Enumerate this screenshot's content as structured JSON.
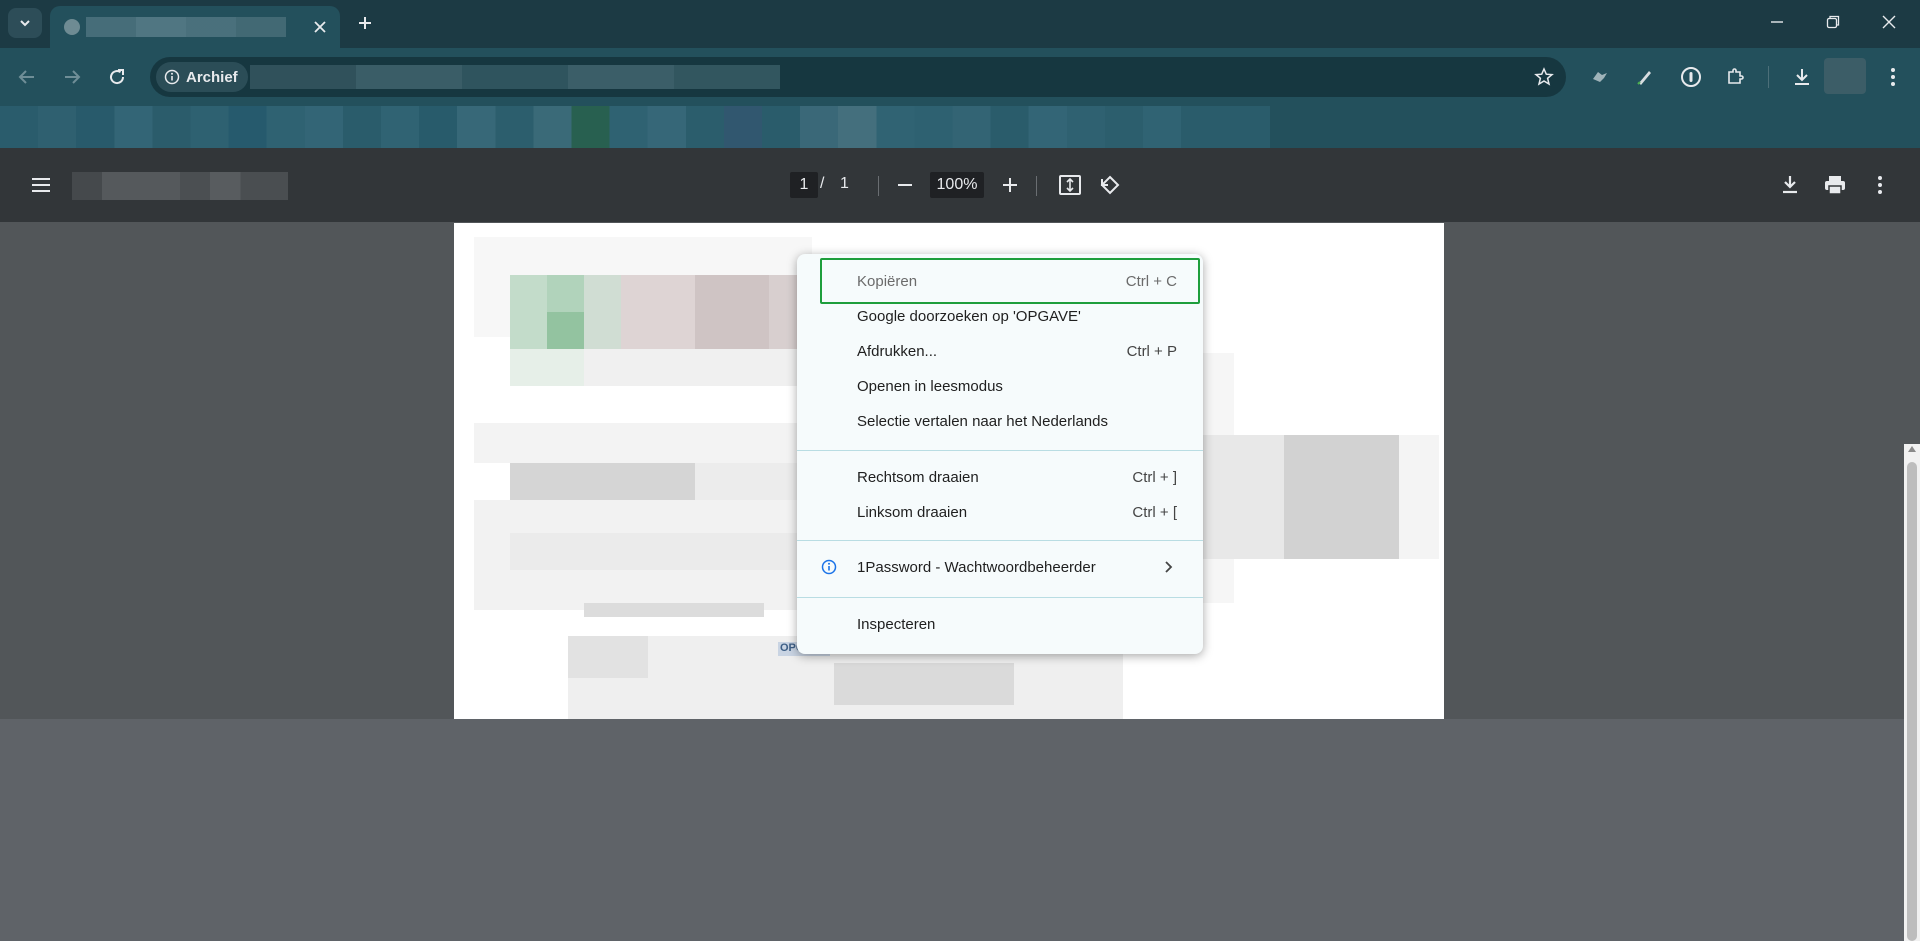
{
  "browser": {
    "site_chip_label": "Archief",
    "icons": {
      "tab_search": "chevron-down-icon",
      "tab_close": "close-icon",
      "new_tab": "plus-icon",
      "minimize": "minimize-icon",
      "restore": "restore-icon",
      "close_window": "close-icon",
      "back": "back-arrow-icon",
      "forward": "forward-arrow-icon",
      "reload": "reload-icon",
      "site_info": "info-icon",
      "bookmark_star": "star-icon",
      "extensions": [
        "bird-extension-icon",
        "pen-extension-icon",
        "password-manager-icon",
        "puzzle-icon"
      ],
      "downloads": "download-icon"
    }
  },
  "pdf_toolbar": {
    "page_current": "1",
    "page_separator": "/",
    "page_total": "1",
    "zoom": "100%",
    "icons": {
      "menu": "hamburger-menu-icon",
      "zoom_out": "minus-icon",
      "zoom_in": "plus-icon",
      "fit": "fit-page-icon",
      "rotate": "rotate-icon",
      "download": "download-icon",
      "print": "print-icon",
      "more": "more-vertical-icon"
    }
  },
  "pdf_content": {
    "selected_text": "OPGAVE"
  },
  "context_menu": {
    "items": [
      {
        "label": "Kopiëren",
        "shortcut": "Ctrl + C",
        "disabled": true
      },
      {
        "label": "Google doorzoeken op 'OPGAVE'",
        "shortcut": ""
      },
      {
        "label": "Afdrukken...",
        "shortcut": "Ctrl + P"
      },
      {
        "label": "Openen in leesmodus",
        "shortcut": ""
      },
      {
        "label": "Selectie vertalen naar het Nederlands",
        "shortcut": ""
      },
      {
        "label": "Rechtsom draaien",
        "shortcut": "Ctrl + ]"
      },
      {
        "label": "Linksom draaien",
        "shortcut": "Ctrl + ["
      },
      {
        "label": "1Password - Wachtwoordbeheerder",
        "shortcut": "",
        "icon": "info-icon",
        "submenu": true
      },
      {
        "label": "Inspecteren",
        "shortcut": ""
      }
    ]
  },
  "colors": {
    "tab_strip": "#1c3a44",
    "toolbar": "#23505c",
    "pdf_toolbar": "#323639",
    "viewer_bg": "#525659",
    "menu_bg": "#f6fbfc",
    "focus_ring": "#1e9e3c",
    "info_icon_blue": "#1a73e8"
  }
}
